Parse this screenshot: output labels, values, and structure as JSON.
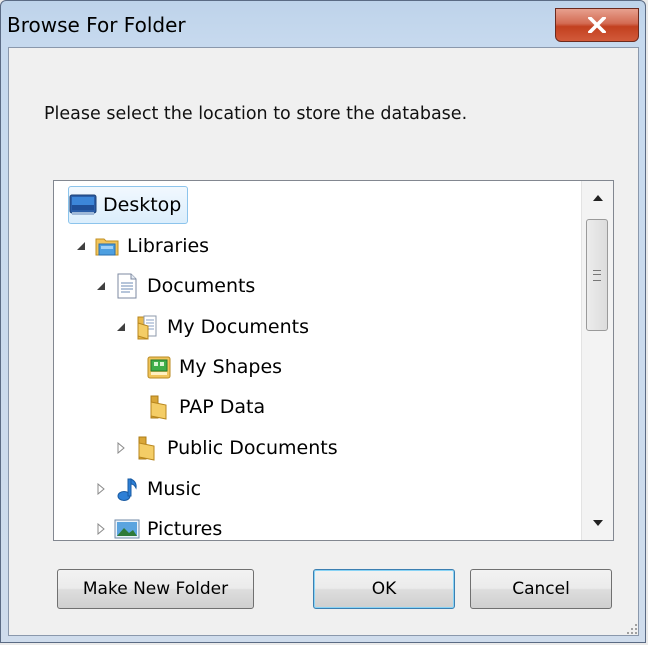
{
  "window": {
    "title": "Browse For Folder",
    "close_label": "X"
  },
  "prompt": "Please select the location to store the database.",
  "tree": {
    "items": [
      {
        "label": "Desktop",
        "icon": "desktop-icon",
        "expander": "none",
        "selected": true
      },
      {
        "label": "Libraries",
        "icon": "libraries-icon",
        "expander": "expanded"
      },
      {
        "label": "Documents",
        "icon": "documents-icon",
        "expander": "expanded"
      },
      {
        "label": "My Documents",
        "icon": "folder-documents-icon",
        "expander": "expanded"
      },
      {
        "label": "My Shapes",
        "icon": "shapes-folder-icon",
        "expander": "none"
      },
      {
        "label": "PAP Data",
        "icon": "folder-icon",
        "expander": "none"
      },
      {
        "label": "Public Documents",
        "icon": "folder-icon",
        "expander": "collapsed"
      },
      {
        "label": "Music",
        "icon": "music-icon",
        "expander": "collapsed"
      },
      {
        "label": "Pictures",
        "icon": "pictures-icon",
        "expander": "collapsed"
      }
    ]
  },
  "buttons": {
    "make_new_folder": "Make New Folder",
    "ok": "OK",
    "cancel": "Cancel"
  },
  "colors": {
    "selection_fill": "#dbeefc",
    "selection_border": "#8cc4ec",
    "close_button": "#c2401f",
    "default_button_border": "#3c7fb1"
  }
}
